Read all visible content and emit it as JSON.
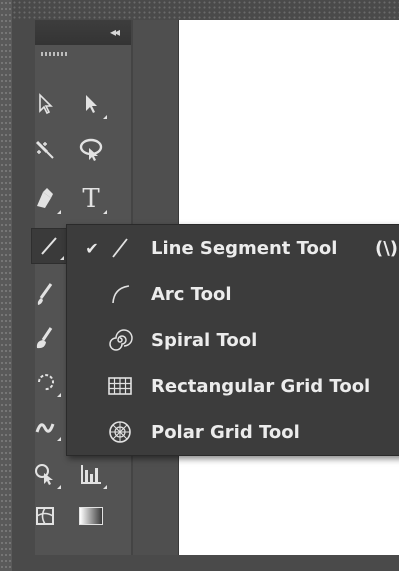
{
  "panel": {
    "collapse_glyph": "◂◂",
    "tools": [
      {
        "name": "direct-selection-tool",
        "icon": "hollow-arrow-icon"
      },
      {
        "name": "selection-tool",
        "icon": "arrow-icon"
      },
      {
        "name": "magic-wand-tool",
        "icon": "magic-wand-icon"
      },
      {
        "name": "lasso-tool",
        "icon": "lasso-icon"
      },
      {
        "name": "pen-tool",
        "icon": "pen-icon"
      },
      {
        "name": "type-tool",
        "icon": "type-icon",
        "glyph": "T"
      },
      {
        "name": "line-segment-tool",
        "icon": "line-icon"
      },
      {
        "name": "paintbrush-tool",
        "icon": "brush-icon"
      },
      {
        "name": "blob-brush-tool",
        "icon": "blob-brush-icon"
      },
      {
        "name": "rotate-tool",
        "icon": "rotate-icon"
      },
      {
        "name": "width-tool",
        "icon": "width-icon"
      },
      {
        "name": "shape-builder-tool",
        "icon": "shape-builder-icon"
      },
      {
        "name": "column-graph-tool",
        "icon": "graph-icon"
      },
      {
        "name": "mesh-tool",
        "icon": "mesh-icon"
      },
      {
        "name": "gradient-tool",
        "icon": "gradient-icon"
      }
    ]
  },
  "flyout": {
    "items": [
      {
        "label": "Line Segment Tool",
        "shortcut": "(\\)",
        "icon": "line-segment-icon",
        "checked": true
      },
      {
        "label": "Arc Tool",
        "shortcut": "",
        "icon": "arc-icon",
        "checked": false
      },
      {
        "label": "Spiral Tool",
        "shortcut": "",
        "icon": "spiral-icon",
        "checked": false
      },
      {
        "label": "Rectangular Grid Tool",
        "shortcut": "",
        "icon": "rectangular-grid-icon",
        "checked": false
      },
      {
        "label": "Polar Grid Tool",
        "shortcut": "",
        "icon": "polar-grid-icon",
        "checked": false
      }
    ],
    "check_glyph": "✔"
  },
  "colors": {
    "panel_bg": "#535353",
    "flyout_bg": "#3c3c3c",
    "text": "#ececec",
    "canvas": "#ffffff"
  }
}
